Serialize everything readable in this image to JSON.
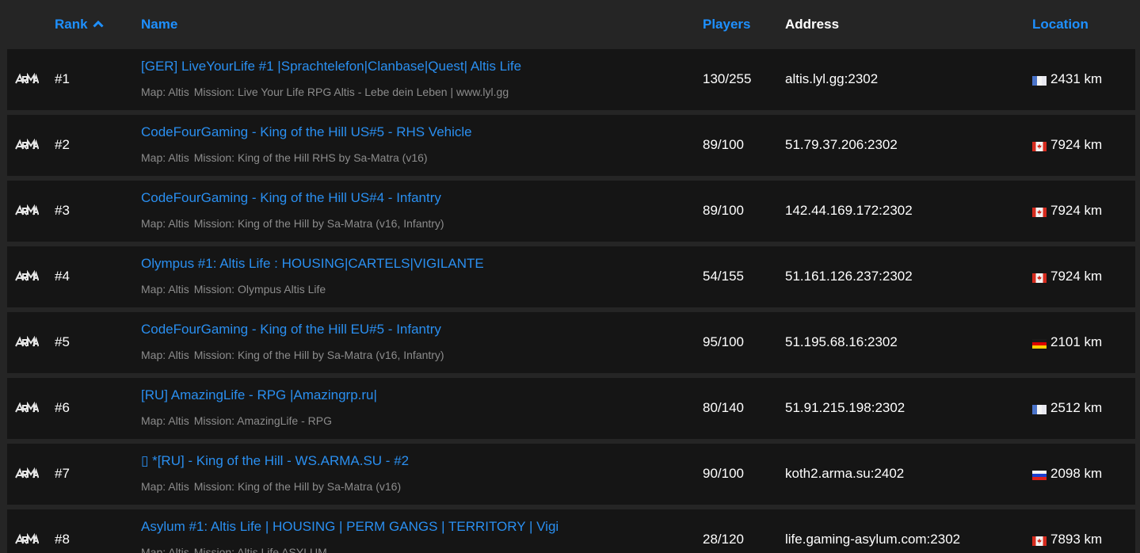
{
  "header": {
    "rank": "Rank",
    "name": "Name",
    "players": "Players",
    "address": "Address",
    "location": "Location",
    "sort_indicator": "chevron-up-icon"
  },
  "colors": {
    "background": "#252525",
    "row_background": "#151515",
    "link": "#2a8ff0",
    "header_link": "#1e90ff",
    "text": "#ffffff",
    "muted": "#8c8c8c"
  },
  "rows": [
    {
      "rank": "#1",
      "name": "[GER] LiveYourLife #1 |Sprachtelefon|Clanbase|Quest| Altis Life",
      "map": "Map: Altis",
      "mission": "Mission: Live Your Life RPG Altis - Lebe dein Leben | www.lyl.gg",
      "players": "130/255",
      "address": "altis.lyl.gg:2302",
      "flag": "fr",
      "distance": "2431 km"
    },
    {
      "rank": "#2",
      "name": "CodeFourGaming - King of the Hill US#5 - RHS Vehicle",
      "map": "Map: Altis",
      "mission": "Mission: King of the Hill RHS by Sa-Matra (v16)",
      "players": "89/100",
      "address": "51.79.37.206:2302",
      "flag": "ca",
      "distance": "7924 km"
    },
    {
      "rank": "#3",
      "name": "CodeFourGaming - King of the Hill US#4 - Infantry",
      "map": "Map: Altis",
      "mission": "Mission: King of the Hill by Sa-Matra (v16, Infantry)",
      "players": "89/100",
      "address": "142.44.169.172:2302",
      "flag": "ca",
      "distance": "7924 km"
    },
    {
      "rank": "#4",
      "name": "Olympus #1: Altis Life : HOUSING|CARTELS|VIGILANTE",
      "map": "Map: Altis",
      "mission": "Mission: Olympus Altis Life",
      "players": "54/155",
      "address": "51.161.126.237:2302",
      "flag": "ca",
      "distance": "7924 km"
    },
    {
      "rank": "#5",
      "name": "CodeFourGaming - King of the Hill EU#5 - Infantry",
      "map": "Map: Altis",
      "mission": "Mission: King of the Hill by Sa-Matra (v16, Infantry)",
      "players": "95/100",
      "address": "51.195.68.16:2302",
      "flag": "de",
      "distance": "2101 km"
    },
    {
      "rank": "#6",
      "name": "[RU] AmazingLife - RPG |Amazingrp.ru|",
      "map": "Map: Altis",
      "mission": "Mission: AmazingLife - RPG",
      "players": "80/140",
      "address": "51.91.215.198:2302",
      "flag": "fr",
      "distance": "2512 km"
    },
    {
      "rank": "#7",
      "name": "▯ *[RU] - King of the Hill - WS.ARMA.SU - #2",
      "map": "Map: Altis",
      "mission": "Mission: King of the Hill by Sa-Matra (v16)",
      "players": "90/100",
      "address": "koth2.arma.su:2402",
      "flag": "ru",
      "distance": "2098 km"
    },
    {
      "rank": "#8",
      "name": "Asylum #1: Altis Life | HOUSING | PERM GANGS | TERRITORY | Vigi",
      "map": "Map: Altis",
      "mission": "Mission: Altis Life ASYLUM",
      "players": "28/120",
      "address": "life.gaming-asylum.com:2302",
      "flag": "ca",
      "distance": "7893 km"
    }
  ]
}
